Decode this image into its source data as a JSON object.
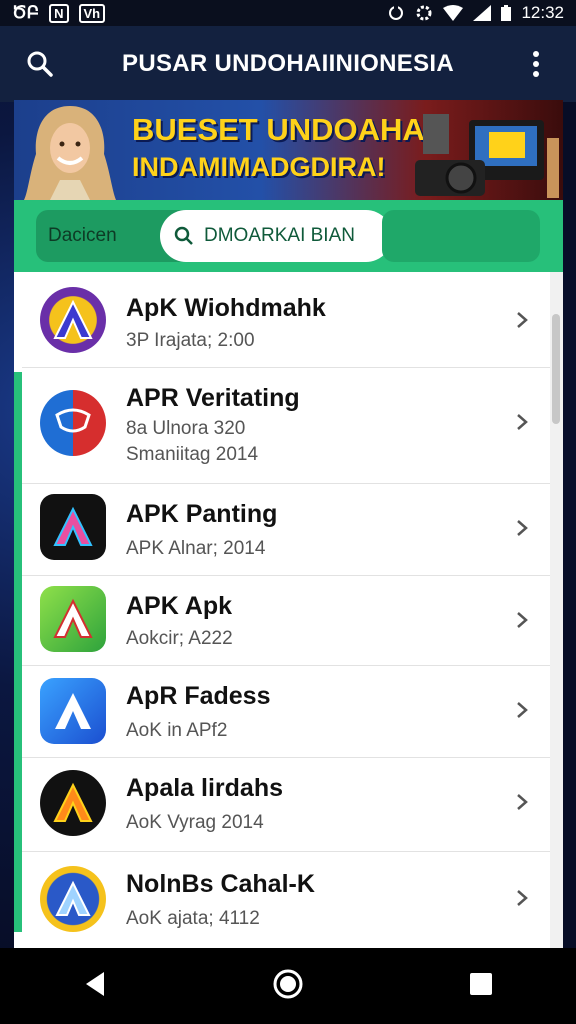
{
  "status_bar": {
    "left_labels": [
      "ԾԲ",
      "N",
      "Vh"
    ],
    "time": "12:32"
  },
  "appbar": {
    "title": "PUSAR UNDOHAIINIONESIA",
    "icons": [
      "search-icon",
      "more-vert-icon"
    ]
  },
  "banner": {
    "line1": "BUESET UNDOAHAN",
    "line2": "INDAMIMADGDIRA!"
  },
  "search_band": {
    "left_label": "Dacicen",
    "search_text": "DMOARKAI BIAN"
  },
  "apps": [
    {
      "name": "ApK Wiohdmahk",
      "lines": [
        "3P Irajata; 2:00"
      ],
      "icon": "app-a-purple-icon"
    },
    {
      "name": "APR Veritating",
      "lines": [
        "8a Ulnora 320",
        "Smaniitag 2014"
      ],
      "icon": "app-shield-icon"
    },
    {
      "name": "APK Panting",
      "lines": [
        "APK Alnar; 2014"
      ],
      "icon": "app-a-black-icon"
    },
    {
      "name": "APK Apk",
      "lines": [
        "Aokcir; A222"
      ],
      "icon": "app-a-green-icon"
    },
    {
      "name": "ApR Fadess",
      "lines": [
        "AoK in APf2"
      ],
      "icon": "app-a-blue-icon"
    },
    {
      "name": "Apala lirdahs",
      "lines": [
        "AoK Vyrag 2014"
      ],
      "icon": "app-a-orange-icon"
    },
    {
      "name": "NolnBs Cahal-K",
      "lines": [
        "AoK ajata; 4112"
      ],
      "icon": "app-badge-icon"
    }
  ],
  "colors": {
    "appbar": "#13213f",
    "green": "#27c07a",
    "banner_text": "#ffd21a"
  },
  "navbar": {
    "icons": [
      "back-icon",
      "home-icon",
      "recents-icon"
    ]
  }
}
